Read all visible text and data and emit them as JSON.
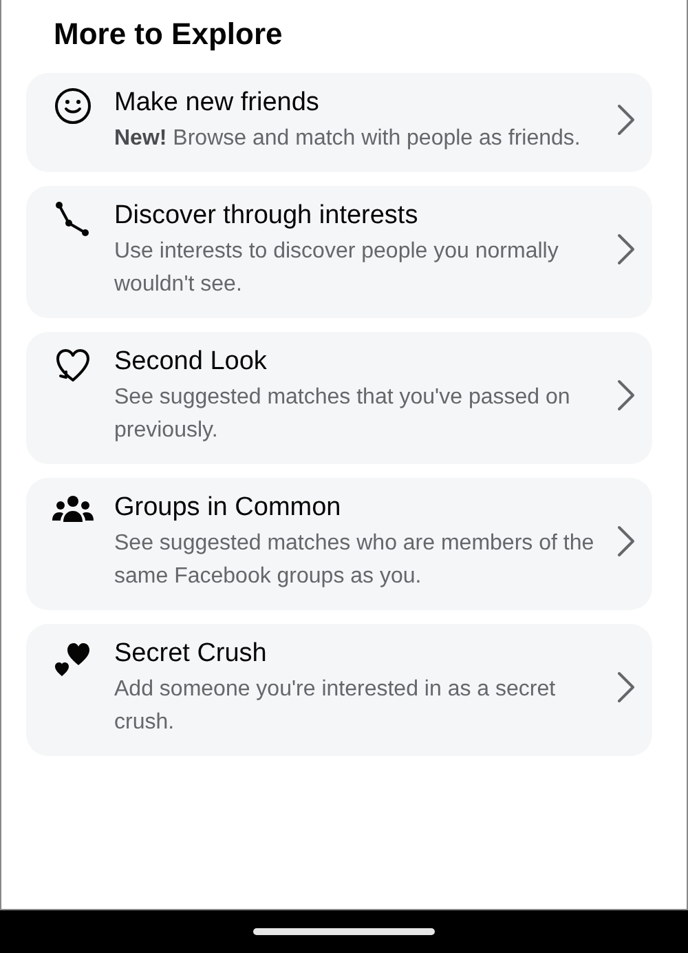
{
  "title": "More to Explore",
  "items": [
    {
      "title": "Make new friends",
      "description": "**New!** Browse and match with people as friends."
    },
    {
      "title": "Discover through interests",
      "description": "Use interests to discover people you normally wouldn't see."
    },
    {
      "title": "Second Look",
      "description": "See suggested matches that you've passed on previously."
    },
    {
      "title": "Groups in Common",
      "description": "See suggested matches who are members of the same Facebook groups as you."
    },
    {
      "title": "Secret Crush",
      "description": "Add someone you're interested in as a secret crush."
    }
  ]
}
